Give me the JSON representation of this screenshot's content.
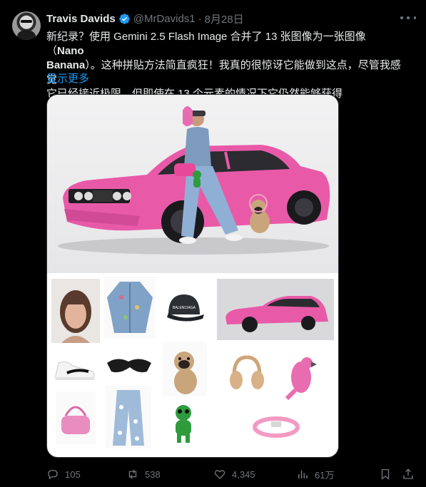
{
  "author": {
    "name": "Travis Davids",
    "handle": "@MrDavids1",
    "separator": "·",
    "date": "8月28日"
  },
  "tweet": {
    "line1_prefix": "新纪录？使用 Gemini 2.5 Flash Image 合并了 13 张图像为一张图像（",
    "line1_bold": "Nano",
    "line2_bold": "Banana",
    "line2_suffix": "）。这种拼贴方法简直疯狂！我真的很惊讶它能做到这点，尽管我感觉",
    "line3": "它已经接近极限，但即使在 13 个元素的情况下它仍然能够获得",
    "show_more": "显示更多"
  },
  "media": {
    "hero_badge": "BALENCIAGA"
  },
  "actions": {
    "replies": "105",
    "reposts": "538",
    "likes": "4,345",
    "views": "61万"
  },
  "colors": {
    "background": "#000000",
    "text": "#e7e9ea",
    "muted": "#71767b",
    "link": "#1d9bf0",
    "verified": "#1d9bf0",
    "car_pink": "#e85aa8"
  }
}
